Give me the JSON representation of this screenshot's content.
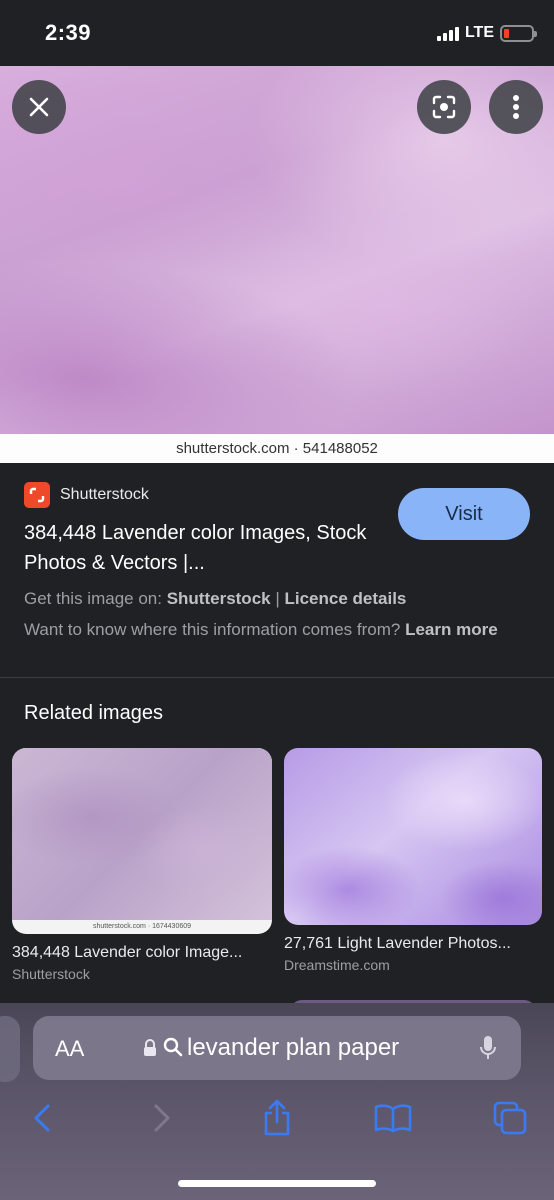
{
  "status_bar": {
    "time": "2:39",
    "network": "LTE"
  },
  "viewer": {
    "watermark": "shutterstock.com · 541488052",
    "buttons": [
      "close-icon",
      "lens-icon",
      "more-vert-icon"
    ]
  },
  "result": {
    "source_name": "Shutterstock",
    "title": "384,448 Lavender color Images, Stock Photos & Vectors |...",
    "visit_label": "Visit",
    "get_prefix": "Get this image on: ",
    "get_source": "Shutterstock",
    "separator": " | ",
    "licence": "Licence details",
    "info_question": "Want to know where this information comes from? ",
    "learn_more": "Learn more"
  },
  "related": {
    "heading": "Related images",
    "items": [
      {
        "title": "384,448 Lavender color Image...",
        "source": "Shutterstock",
        "watermark": "shutterstock.com · 1674430609"
      },
      {
        "title": "27,761 Light Lavender Photos...",
        "source": "Dreamstime.com"
      }
    ]
  },
  "browser": {
    "aa_label": "AA",
    "address_text": "levander plan paper",
    "toolbar": [
      "back-icon",
      "forward-icon",
      "share-icon",
      "bookmarks-icon",
      "tabs-icon"
    ]
  },
  "colors": {
    "background": "#202124",
    "visit_button": "#8ab4f8",
    "shutterstock_brand": "#ee4a2a",
    "safari_accent": "#3a7bf5"
  }
}
